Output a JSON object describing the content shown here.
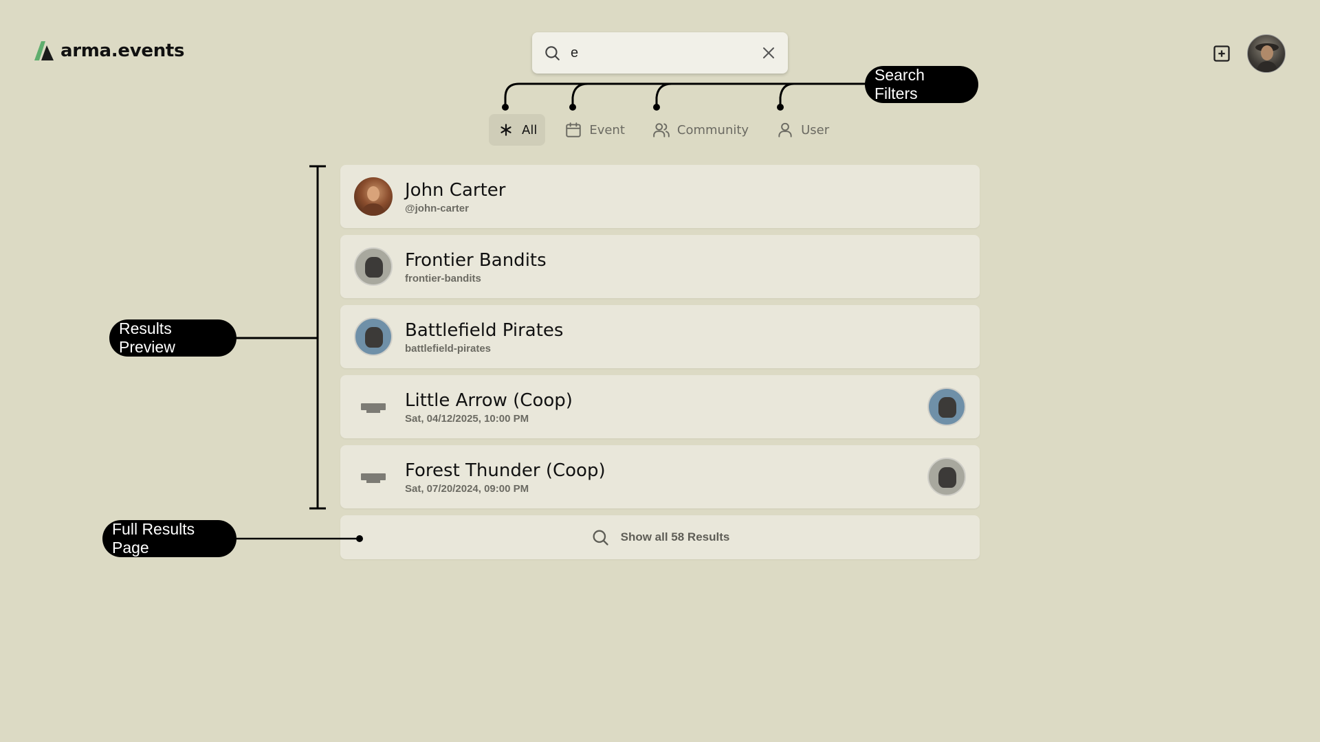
{
  "app": {
    "name": "arma.events"
  },
  "search": {
    "value": "e"
  },
  "filters": [
    {
      "label": "All",
      "icon": "asterisk-icon",
      "active": true
    },
    {
      "label": "Event",
      "icon": "calendar-icon",
      "active": false
    },
    {
      "label": "Community",
      "icon": "users-icon",
      "active": false
    },
    {
      "label": "User",
      "icon": "user-icon",
      "active": false
    }
  ],
  "results": [
    {
      "title": "John Carter",
      "subtitle": "@john-carter",
      "type": "user"
    },
    {
      "title": "Frontier Bandits",
      "subtitle": "frontier-bandits",
      "type": "community"
    },
    {
      "title": "Battlefield Pirates",
      "subtitle": "battlefield-pirates",
      "type": "community"
    },
    {
      "title": "Little Arrow (Coop)",
      "subtitle": "Sat, 04/12/2025, 10:00 PM",
      "type": "event"
    },
    {
      "title": "Forest Thunder (Coop)",
      "subtitle": "Sat, 07/20/2024, 09:00 PM",
      "type": "event"
    }
  ],
  "show_all": {
    "label": "Show all 58 Results"
  },
  "annotations": {
    "search_filters": "Search Filters",
    "results_preview": "Results Preview",
    "full_results_page": "Full Results Page"
  },
  "colors": {
    "background": "#dcdac4",
    "card": "#e9e7da",
    "active_filter": "#cfcdb8",
    "logo_green": "#4caf6a",
    "annotation": "#000000"
  }
}
